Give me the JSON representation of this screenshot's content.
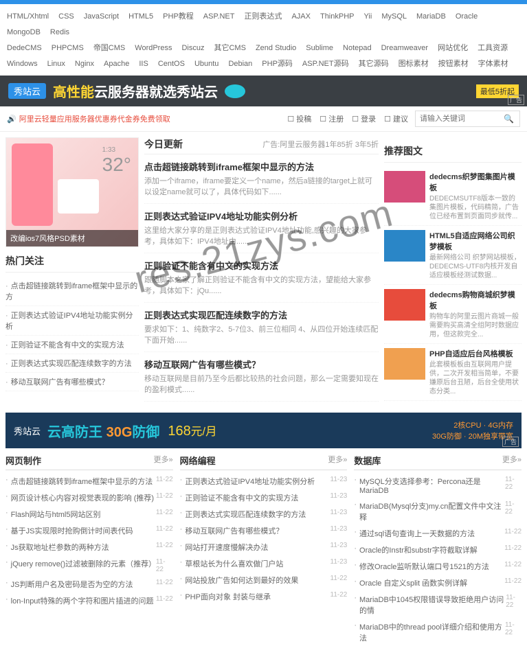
{
  "watermark": "res.21zys.com",
  "nav_rows": [
    [
      "HTML/Xhtml",
      "CSS",
      "JavaScript",
      "HTML5",
      "PHP教程",
      "ASP.NET",
      "正则表达式",
      "AJAX",
      "ThinkPHP",
      "Yii",
      "MySQL",
      "MariaDB",
      "Oracle",
      "MongoDB",
      "Redis"
    ],
    [
      "DedeCMS",
      "PHPCMS",
      "帝国CMS",
      "WordPress",
      "Discuz",
      "其它CMS",
      "Zend Studio",
      "Sublime",
      "Notepad",
      "Dreamweaver",
      "网站优化",
      "工具资源"
    ],
    [
      "Windows",
      "Linux",
      "Nginx",
      "Apache",
      "IIS",
      "CentOS",
      "Ubuntu",
      "Debian",
      "PHP源码",
      "ASP.NET源码",
      "其它源码",
      "图标素材",
      "按钮素材",
      "字体素材"
    ]
  ],
  "banner1": {
    "logo": "秀站云",
    "t1": "高性能",
    "t2": "云服务器就选秀站云",
    "badge": "最低5折起",
    "ad": "广告"
  },
  "subbar": {
    "notice": "阿里云轻量应用服务器优惠券代金券免费领取",
    "actions": [
      "投稿",
      "注册",
      "登录",
      "建议"
    ],
    "search_ph": "请输入关键词"
  },
  "slider": {
    "temp": "32°",
    "time": "1:33",
    "caption": "改编ios7风格PSD素材"
  },
  "hot": {
    "title": "热门关注",
    "items": [
      "点击超链接跳转到iframe框架中显示的方",
      "正则表达式验证IPV4地址功能实例分析",
      "正则验证不能含有中文的实现方法",
      "正则表达式实现匹配连续数字的方法",
      "移动互联网广告有哪些模式？"
    ]
  },
  "today": {
    "title": "今日更新",
    "ad": "广告:阿里云服务器1年85折 3年5折",
    "articles": [
      {
        "t": "点击超链接跳转到iframe框架中显示的方法",
        "d": "添加一个iframe，iframe要定义一个name，然后a链接的target上就可以设定name就可以了，具体代码如下......"
      },
      {
        "t": "正则表达式验证IPV4地址功能实例分析",
        "d": "这里给大家分享的是正则表达式验证IPV4地址功能,感兴趣的大家参考，具体如下：IPV4地址由......"
      },
      {
        "t": "正则验证不能含有中文的实现方法",
        "d": "跟随脚本之家了解正则验证不能含有中文的实现方法，望能给大家参考，具体如下：jQu......"
      },
      {
        "t": "正则表达式实现匹配连续数字的方法",
        "d": "要求如下：1、纯数字2、5-7位3、前三位相同 4、从四位开始连续匹配下面开始......"
      },
      {
        "t": "移动互联网广告有哪些模式？",
        "d": "移动互联网是目前乃至今后都比较热的社会问题，那么一定需要知现在的盈利模式......"
      }
    ]
  },
  "rec": {
    "title": "推荐图文",
    "items": [
      {
        "t": "dedecms织梦图集图片模板",
        "d": "DEDECMSUTF8版本一致的集图片模板，代码精简，广告位已经布置到页面同步就传..."
      },
      {
        "t": "HTML5自适应网络公司织梦模板",
        "d": "最新网络公司 织梦网站模板，DEDECMS-UTF8内核开发自适应模板经测试数据..."
      },
      {
        "t": "dedecms购物商城织梦模板",
        "d": "购物车的阿里云图片商城一般需要购买高清全组阿时数据应用，但这款完全..."
      },
      {
        "t": "PHP自适应后台风格模板",
        "d": "此套模板板由互联网用户提供，二次开发相当简单，不要嫌原后台丑陋，后台全使用状态分类..."
      }
    ]
  },
  "banner2": {
    "logo": "秀站云",
    "t1": "云高防王",
    "t2": "30G",
    "t3": "防御",
    "price": "168",
    "unit": "元/月",
    "spec1": "2核CPU · 4G内存",
    "spec2": "30G防御 · 20M独享带宽",
    "ad": "广告"
  },
  "cols": [
    {
      "title": "网页制作",
      "more": "更多»",
      "items": [
        [
          "点击超链接跳转到iframe框架中显示的方法",
          "11-22"
        ],
        [
          "网页设计核心内容对视觉表现的影响 (推荐)",
          "11-22"
        ],
        [
          "Flash网站与html5网站区别",
          "11-22"
        ],
        [
          "基于JS实现限时抢购倒计时间表代码",
          "11-22"
        ],
        [
          "Js获取地址栏参数的两种方法",
          "11-22"
        ],
        [
          "jQuery remove()过滤被删除的元素（推荐）",
          "11-22"
        ],
        [
          "JS判断用户名及密码是否为空的方法",
          "11-22"
        ],
        [
          "lon-Input特殊的两个字符和图片插进的问题",
          "11-22"
        ]
      ]
    },
    {
      "title": "网络编程",
      "more": "更多»",
      "items": [
        [
          "正则表达式验证IPV4地址功能实例分析",
          "11-23"
        ],
        [
          "正则验证不能含有中文的实现方法",
          "11-23"
        ],
        [
          "正则表达式实现匹配连续数字的方法",
          "11-23"
        ],
        [
          "移动互联网广告有哪些模式？",
          "11-23"
        ],
        [
          "网站打开速度慢解决办法",
          "11-23"
        ],
        [
          "草根站长为什么喜欢做门户站",
          "11-23"
        ],
        [
          "网站投放广告如何达到最好的效果",
          "11-22"
        ],
        [
          "PHP面向对象 封装与继承",
          "11-22"
        ]
      ]
    },
    {
      "title": "数据库",
      "more": "更多»",
      "items": [
        [
          "MySQL分支选择参考：Percona还是MariaDB",
          "11-22"
        ],
        [
          "MariaDB(Mysql分支)my.cn配置文件中文注释",
          "11-22"
        ],
        [
          "通过sql语句查询上一天数据的方法",
          "11-22"
        ],
        [
          "Oracle的Instr和substr字符截取详解",
          "11-22"
        ],
        [
          "修改Oracle监听默认端口号1521的方法",
          "11-22"
        ],
        [
          "Oracle 自定义split 函数实例详解",
          "11-22"
        ],
        [
          "MariaDB中1045权限错误导致拒绝用户访问的情",
          "11-22"
        ],
        [
          "MariaDB中的thread pool详细介绍和使用方法",
          "11-22"
        ]
      ]
    }
  ]
}
